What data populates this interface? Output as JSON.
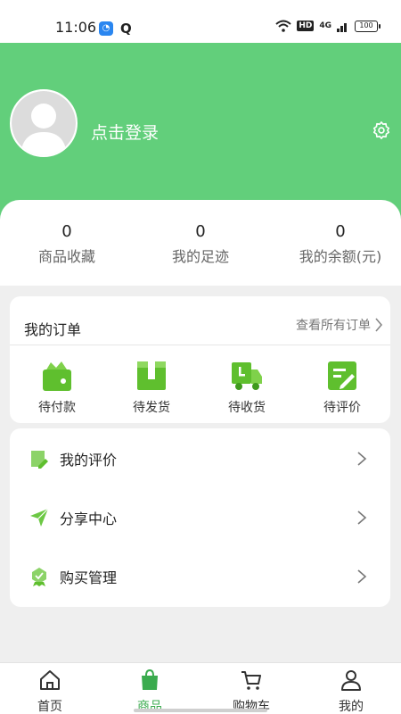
{
  "status_bar": {
    "time": "11:06",
    "network": "4G",
    "hd": "HD",
    "battery": "100"
  },
  "header": {
    "login_text": "点击登录"
  },
  "stats": [
    {
      "value": "0",
      "label": "商品收藏"
    },
    {
      "value": "0",
      "label": "我的足迹"
    },
    {
      "value": "0",
      "label": "我的余额(元)"
    }
  ],
  "orders": {
    "title": "我的订单",
    "view_all": "查看所有订单",
    "items": [
      {
        "label": "待付款",
        "icon": "wallet-icon"
      },
      {
        "label": "待发货",
        "icon": "package-icon"
      },
      {
        "label": "待收货",
        "icon": "delivery-truck-icon"
      },
      {
        "label": "待评价",
        "icon": "review-pen-icon"
      }
    ]
  },
  "menu": [
    {
      "label": "我的评价",
      "icon": "note-pen-icon"
    },
    {
      "label": "分享中心",
      "icon": "paper-plane-icon"
    },
    {
      "label": "购买管理",
      "icon": "badge-check-icon"
    }
  ],
  "tabs": [
    {
      "label": "首页",
      "icon": "home-icon"
    },
    {
      "label": "商品",
      "icon": "shopping-bag-icon"
    },
    {
      "label": "购物车",
      "icon": "cart-icon"
    },
    {
      "label": "我的",
      "icon": "user-icon"
    }
  ],
  "colors": {
    "brand": "#62cf7b",
    "accent": "#3aab4e",
    "icon_green": "#66c23a"
  }
}
